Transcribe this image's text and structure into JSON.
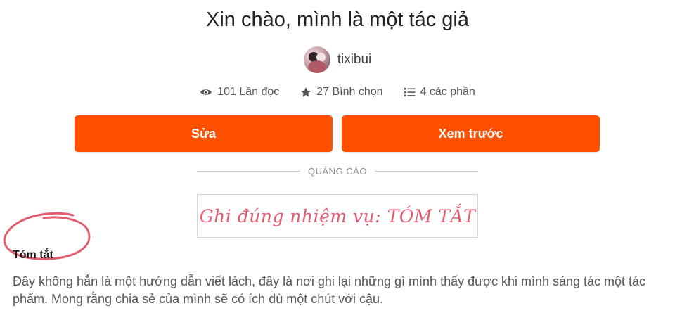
{
  "story": {
    "title": "Xin chào, mình là một tác giả",
    "author": "tixibui"
  },
  "stats": {
    "reads": "101 Lần đọc",
    "votes": "27 Bình chọn",
    "parts": "4 các phần"
  },
  "actions": {
    "edit_label": "Sửa",
    "preview_label": "Xem trước"
  },
  "ad": {
    "label": "QUẢNG CÁO"
  },
  "annotation": {
    "note": "Ghi đúng nhiệm vụ: TÓM TẮT"
  },
  "summary": {
    "heading": "Tóm tắt",
    "text": "Đây không hẳn là một hướng dẫn viết lách, đây là nơi ghi lại những gì mình thấy được khi mình sáng tác một tác phẩm. Mong rằng chia sẻ của mình sẽ có ích dù một chút với cậu."
  },
  "colors": {
    "accent": "#ff5000",
    "annotation": "#e35b6f",
    "text": "#222222",
    "muted": "#555555"
  },
  "icons": {
    "reads": "eye-icon",
    "votes": "star-icon",
    "parts": "list-icon"
  }
}
